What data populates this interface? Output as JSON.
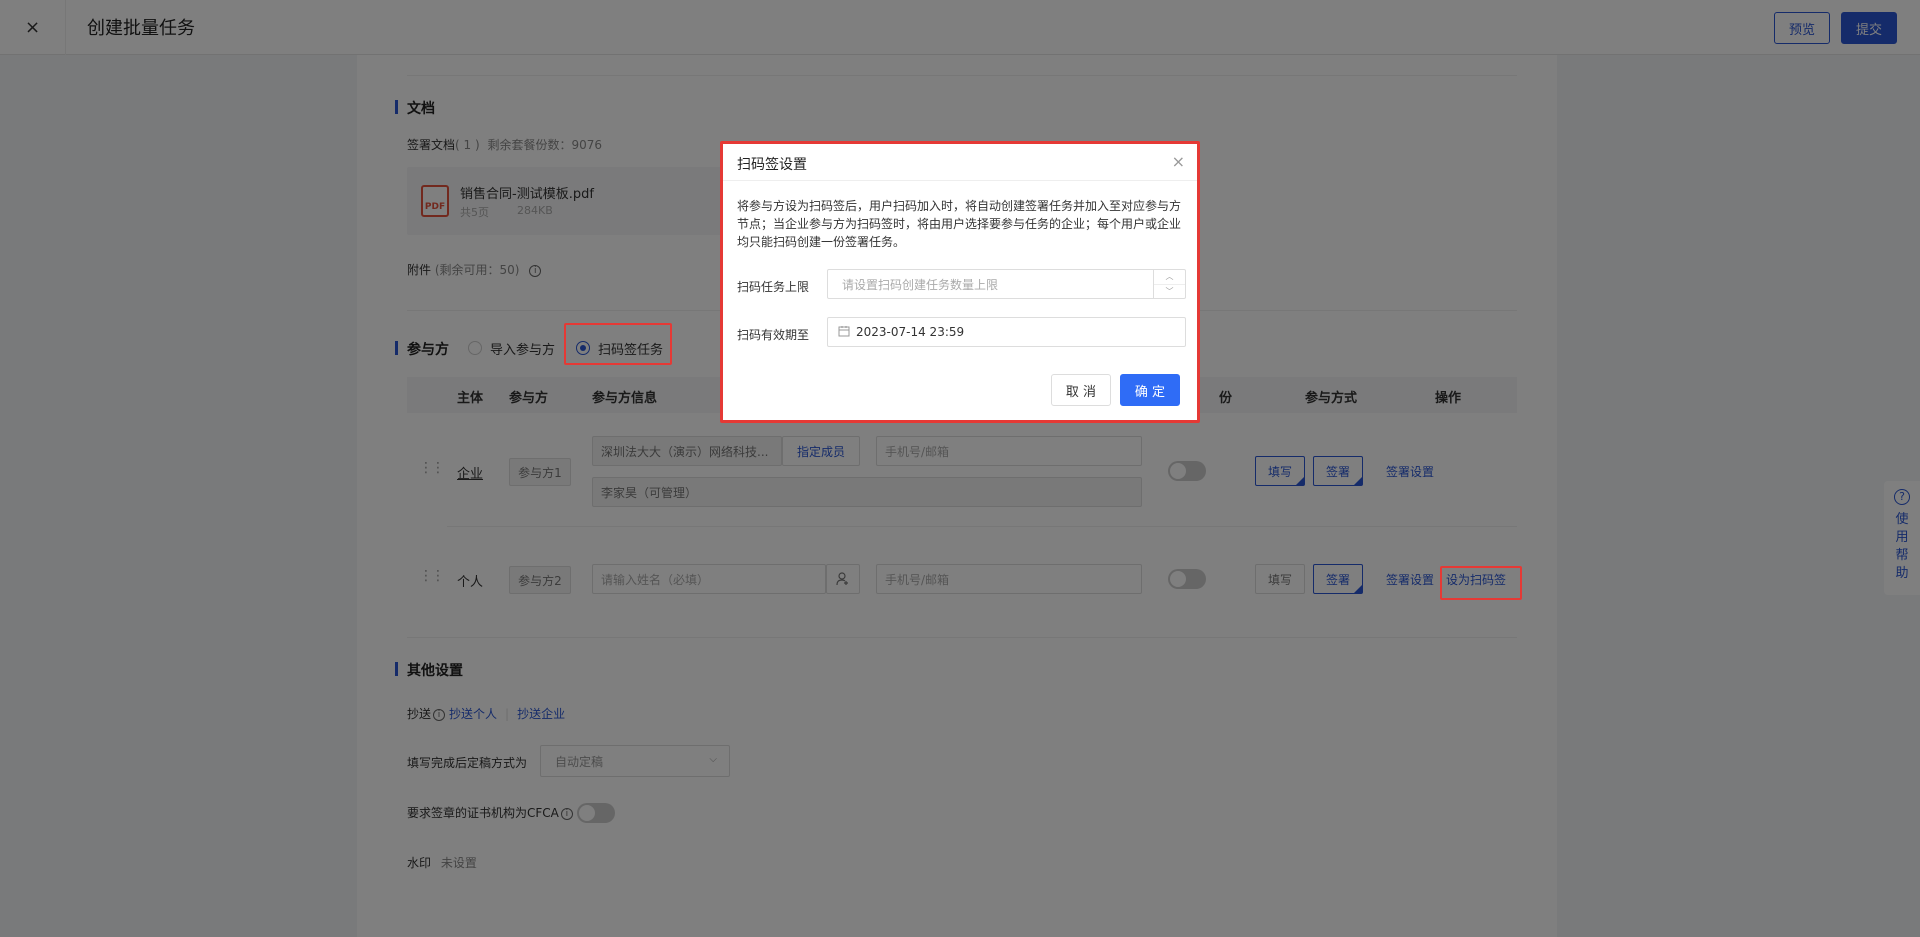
{
  "header": {
    "close_glyph": "×",
    "title": "创建批量任务",
    "preview_label": "预览",
    "submit_label": "提交"
  },
  "documents": {
    "section_title": "文档",
    "sign_docs_label": "签署文档",
    "sign_docs_count": "( 1 )",
    "remaining_text": "剩余套餐份数：9076",
    "file_name": "销售合同-测试模板.pdf",
    "file_pages": "共5页",
    "file_size": "284KB",
    "file_icon_text": "PDF",
    "attachment_label": "附件",
    "attachment_remaining": "(剩余可用：50)",
    "info_glyph": "i"
  },
  "participants": {
    "section_title": "参与方",
    "option_import": "导入参与方",
    "option_scan": "扫码签任务",
    "columns": [
      "主体",
      "参与方",
      "参与方信息",
      "份",
      "参与方式",
      "操作"
    ],
    "rows": [
      {
        "type": "企业",
        "tag": "参与方1",
        "company": "深圳法大大（演示）网络科技...",
        "assign_member": "指定成员",
        "contact_placeholder": "手机号/邮箱",
        "member": "李家昊（可管理）",
        "fill_label": "填写",
        "sign_label": "签署",
        "action_settings": "签署设置"
      },
      {
        "type": "个人",
        "tag": "参与方2",
        "name_placeholder": "请输入姓名（必填）",
        "contact_placeholder": "手机号/邮箱",
        "fill_label": "填写",
        "sign_label": "签署",
        "action_settings": "签署设置",
        "action_scan": "设为扫码签"
      }
    ]
  },
  "other": {
    "section_title": "其他设置",
    "cc_label": "抄送",
    "cc_person": "抄送个人",
    "cc_company": "抄送企业",
    "finalize_label": "填写完成后定稿方式为",
    "finalize_value": "自动定稿",
    "cfca_label": "要求签章的证书机构为CFCA",
    "watermark_label": "水印",
    "watermark_value": "未设置"
  },
  "help": {
    "q_glyph": "?",
    "chars": [
      "使",
      "用",
      "帮",
      "助"
    ]
  },
  "modal": {
    "title": "扫码签设置",
    "close_glyph": "×",
    "description": "将参与方设为扫码签后，用户扫码加入时，将自动创建签署任务并加入至对应参与方节点；当企业参与方为扫码签时，将由用户选择要参与任务的企业；每个用户或企业均只能扫码创建一份签署任务。",
    "limit_label": "扫码任务上限",
    "limit_placeholder": "请设置扫码创建任务数量上限",
    "expiry_label": "扫码有效期至",
    "expiry_value": "2023-07-14 23:59",
    "cancel_label": "取 消",
    "ok_label": "确 定"
  },
  "colors": {
    "primary": "#2b57d4",
    "highlight": "#e53935",
    "confirm": "#2f6cf6"
  }
}
